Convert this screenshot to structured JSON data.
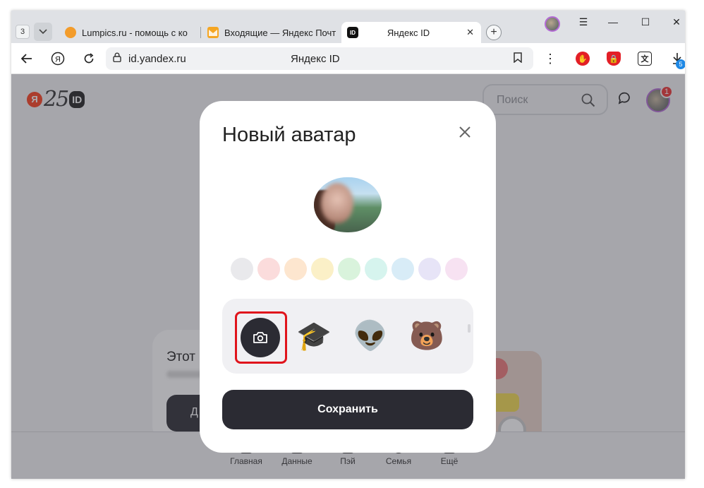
{
  "browser": {
    "tab_count": "3",
    "tabs": [
      {
        "label": "Lumpics.ru - помощь с ко",
        "icon": "lumpics-icon"
      },
      {
        "label": "Входящие — Яндекс Почт",
        "icon": "mail-icon"
      },
      {
        "label": "Яндекс ID",
        "icon": "yandex-id-icon"
      }
    ],
    "url": "id.yandex.ru",
    "page_title": "Яндекс ID",
    "download_badge": "5"
  },
  "header": {
    "logo_letter": "Я",
    "logo_number": "25",
    "logo_id": "ID",
    "search_placeholder": "Поиск",
    "notification_count": "1"
  },
  "background_card": {
    "title": "Этот",
    "button_label": "Д"
  },
  "bottom_nav": [
    {
      "label": "Главная"
    },
    {
      "label": "Данные"
    },
    {
      "label": "Пэй"
    },
    {
      "label": "Семья"
    },
    {
      "label": "Ещё"
    }
  ],
  "modal": {
    "title": "Новый аватар",
    "swatch_colors": [
      "#e9e9ec",
      "#fbdcdc",
      "#fde6cf",
      "#fbf0c7",
      "#d9f3dc",
      "#d6f4ee",
      "#d8ecf7",
      "#e7e4f7",
      "#f7e2f2"
    ],
    "stickers": [
      {
        "name": "camera-upload",
        "glyph": ""
      },
      {
        "name": "graduation-cap",
        "glyph": "🎓"
      },
      {
        "name": "alien",
        "glyph": "👽"
      },
      {
        "name": "bear",
        "glyph": "🐻"
      }
    ],
    "save_label": "Сохранить"
  }
}
